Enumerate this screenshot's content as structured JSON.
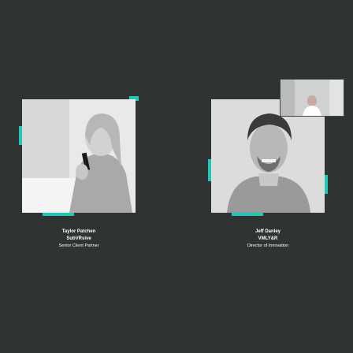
{
  "speakers": [
    {
      "name": "Taylor Patchen",
      "company": "SubVRsive",
      "title": "Senior Client Partner"
    },
    {
      "name": "Jeff Danley",
      "company": "VMLY&R",
      "title": "Director of Innovation"
    }
  ],
  "colors": {
    "background": "#2f3332",
    "accent": "#1fc7b8"
  }
}
